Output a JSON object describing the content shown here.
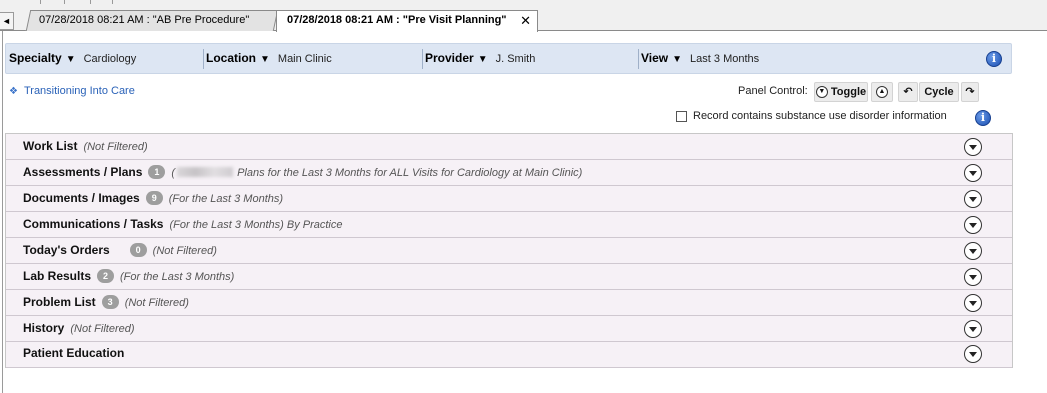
{
  "tabs": [
    {
      "label": "07/28/2018 08:21 AM : \"AB Pre Procedure\"",
      "active": false
    },
    {
      "label": "07/28/2018 08:21 AM : \"Pre Visit Planning\"",
      "active": true,
      "close": "✕"
    }
  ],
  "tab_scroll_icon": "◄",
  "filters": [
    {
      "label": "Specialty",
      "value": "Cardiology"
    },
    {
      "label": "Location",
      "value": "Main Clinic"
    },
    {
      "label": "Provider",
      "value": "J. Smith"
    },
    {
      "label": "View",
      "value": "Last 3 Months"
    }
  ],
  "filter_arrow": "▼",
  "info_icon": "i",
  "transitioning_link": {
    "icon": "❖",
    "label": "Transitioning Into Care"
  },
  "panel_control": {
    "label": "Panel Control:",
    "toggle": "Toggle",
    "cycle": "Cycle"
  },
  "sud_checkbox": {
    "label": "Record contains substance use disorder information",
    "checked": false
  },
  "panels": [
    {
      "title": "Work List",
      "badge": "",
      "note": "(Not Filtered)"
    },
    {
      "title": "Assessments / Plans",
      "badge": "1",
      "note": "Plans for the Last 3 Months for ALL Visits for Cardiology at Main Clinic)",
      "note_prefix": "("
    },
    {
      "title": "Documents / Images",
      "badge": "9",
      "note": "(For the Last 3 Months)"
    },
    {
      "title": "Communications / Tasks",
      "badge": "",
      "note": "(For the Last 3 Months) By Practice"
    },
    {
      "title": "Today's Orders",
      "badge": "0",
      "note": "(Not Filtered)"
    },
    {
      "title": "Lab Results",
      "badge": "2",
      "note": "(For the Last 3 Months)"
    },
    {
      "title": "Problem List",
      "badge": "3",
      "note": "(Not Filtered)"
    },
    {
      "title": "History",
      "badge": "",
      "note": "(Not Filtered)"
    },
    {
      "title": "Patient Education",
      "badge": "",
      "note": ""
    }
  ],
  "colors": {
    "filter_bar_bg": "#dde6f3",
    "panel_row_bg": "#f6f1f6",
    "link": "#2a62b8",
    "badge_bg": "#9e9e9e"
  }
}
